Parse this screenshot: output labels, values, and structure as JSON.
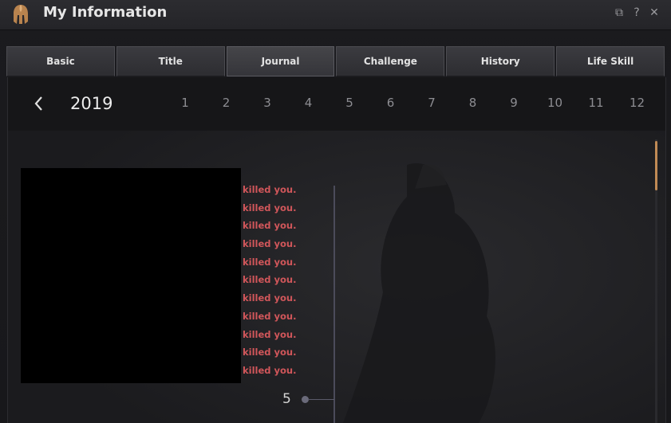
{
  "window": {
    "title": "My Information",
    "logo_icon": "spartan-helmet-icon",
    "buttons": [
      {
        "icon": "restore-icon",
        "glyph": "⧉"
      },
      {
        "icon": "help-icon",
        "glyph": "?"
      },
      {
        "icon": "close-icon",
        "glyph": "✕"
      }
    ]
  },
  "tabs": [
    {
      "label": "Basic",
      "active": false
    },
    {
      "label": "Title",
      "active": false
    },
    {
      "label": "Journal",
      "active": true
    },
    {
      "label": "Challenge",
      "active": false
    },
    {
      "label": "History",
      "active": false
    },
    {
      "label": "Life Skill",
      "active": false
    }
  ],
  "journal": {
    "year": "2019",
    "prev_icon": "chevron-left-icon",
    "months": [
      "1",
      "2",
      "3",
      "4",
      "5",
      "6",
      "7",
      "8",
      "9",
      "10",
      "11",
      "12"
    ],
    "entries": [
      "killed you.",
      "killed you.",
      "killed you.",
      "killed you.",
      "killed you.",
      "killed you.",
      "killed you.",
      "killed you.",
      "killed you.",
      "killed you.",
      "killed you."
    ],
    "day": "5"
  },
  "colors": {
    "accent": "#c08a55",
    "kill_text": "#d0565a"
  }
}
